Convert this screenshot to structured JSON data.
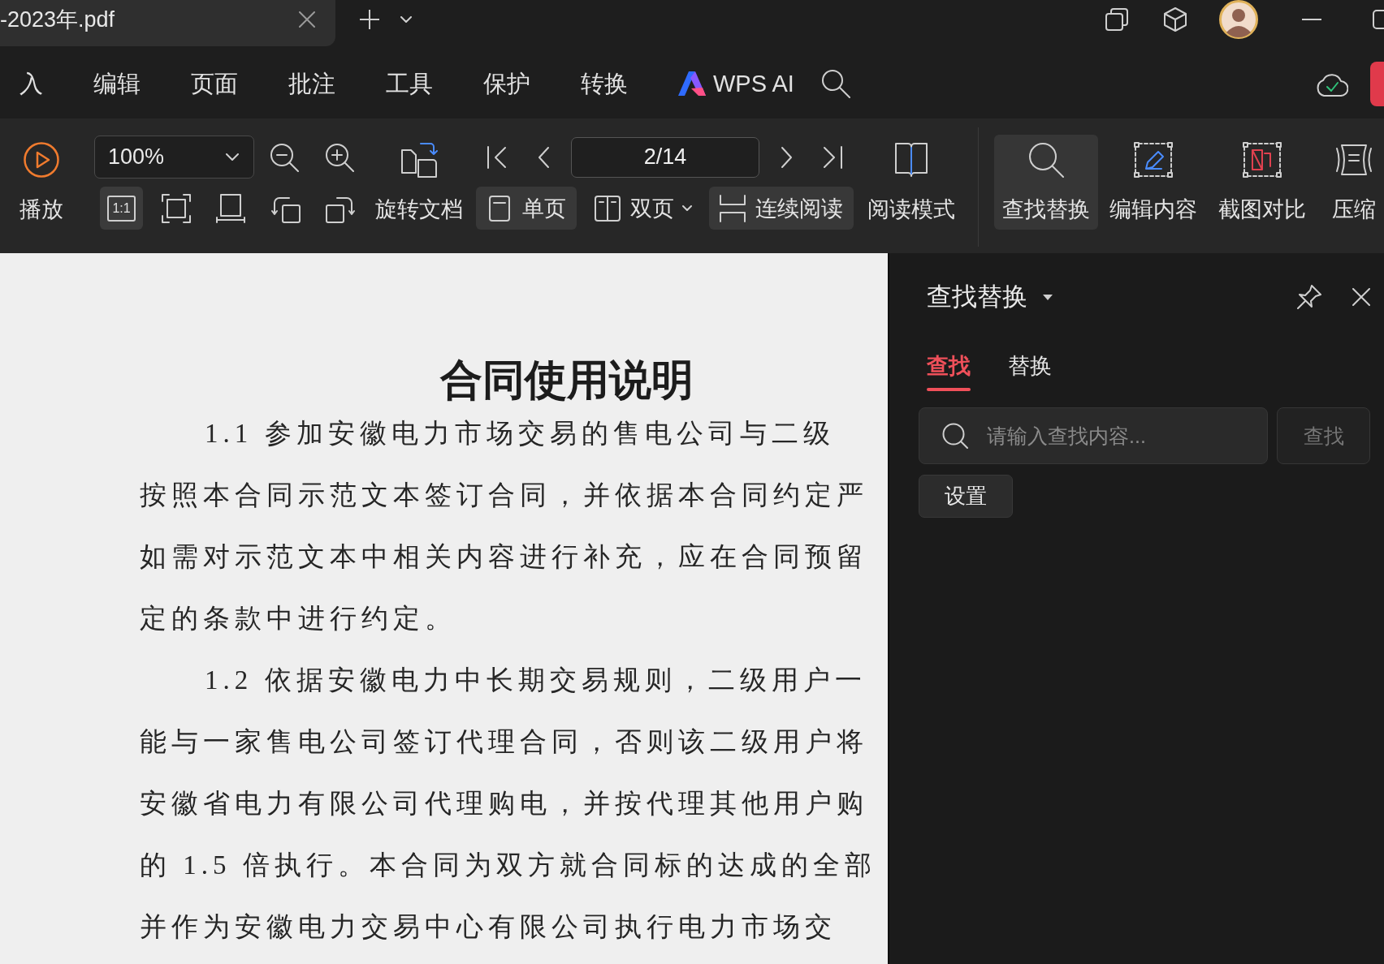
{
  "title_bar": {
    "tabs": [
      {
        "label": "-2023年.pdf",
        "selected": true
      }
    ]
  },
  "menu": {
    "items": [
      {
        "label": "入",
        "kind": "text",
        "selected": false
      },
      {
        "label": "编辑",
        "kind": "text",
        "selected": false
      },
      {
        "label": "页面",
        "kind": "text",
        "selected": false
      },
      {
        "label": "批注",
        "kind": "text",
        "selected": false
      },
      {
        "label": "工具",
        "kind": "text",
        "selected": false
      },
      {
        "label": "保护",
        "kind": "text",
        "selected": false
      },
      {
        "label": "转换",
        "kind": "text",
        "selected": false
      },
      {
        "label": "WPS AI",
        "kind": "ai",
        "selected": false
      }
    ]
  },
  "toolbar": {
    "play": {
      "label": "播放"
    },
    "zoom": {
      "value": "100%"
    },
    "fit_buttons": [
      {
        "kind": "actual-size",
        "label": "1:1",
        "selected": true
      },
      {
        "kind": "fit-page",
        "selected": false
      },
      {
        "kind": "fit-width",
        "selected": false
      }
    ],
    "rotate_document": {
      "label": "旋转文档"
    },
    "page": {
      "value": "2/14"
    },
    "layout_buttons": [
      {
        "label": "单页",
        "kind": "single",
        "selected": true
      },
      {
        "label": "双页",
        "kind": "double",
        "selected": false
      },
      {
        "label": "连续阅读",
        "kind": "continuous",
        "selected": true
      }
    ],
    "read_mode": {
      "label": "阅读模式"
    },
    "tools": [
      {
        "label": "查找替换",
        "kind": "search",
        "selected": true
      },
      {
        "label": "编辑内容",
        "kind": "edit",
        "selected": false
      },
      {
        "label": "截图对比",
        "kind": "compare",
        "selected": false
      },
      {
        "label": "压缩",
        "kind": "compress",
        "selected": false
      }
    ]
  },
  "document": {
    "title": "合同使用说明",
    "paragraphs": [
      {
        "lines": [
          "1.1 参加安徽电力市场交易的售电公司与二级",
          "按照本合同示范文本签订合同，并依据本合同约定严",
          "如需对示范文本中相关内容进行补充，应在合同预留",
          "定的条款中进行约定。"
        ]
      },
      {
        "lines": [
          "1.2 依据安徽电力中长期交易规则，二级用户一",
          "能与一家售电公司签订代理合同，否则该二级用户将",
          "安徽省电力有限公司代理购电，并按代理其他用户购",
          "的 1.5 倍执行。本合同为双方就合同标的达成的全部",
          "并作为安徽电力交易中心有限公司执行电力市场交"
        ]
      }
    ]
  },
  "find_panel": {
    "title": "查找替换",
    "tabs": [
      {
        "label": "查找",
        "selected": true
      },
      {
        "label": "替换",
        "selected": false
      }
    ],
    "search": {
      "placeholder": "请输入查找内容..."
    },
    "find_button": {
      "label": "查找",
      "disabled": true
    },
    "settings_button": {
      "label": "设置"
    }
  }
}
